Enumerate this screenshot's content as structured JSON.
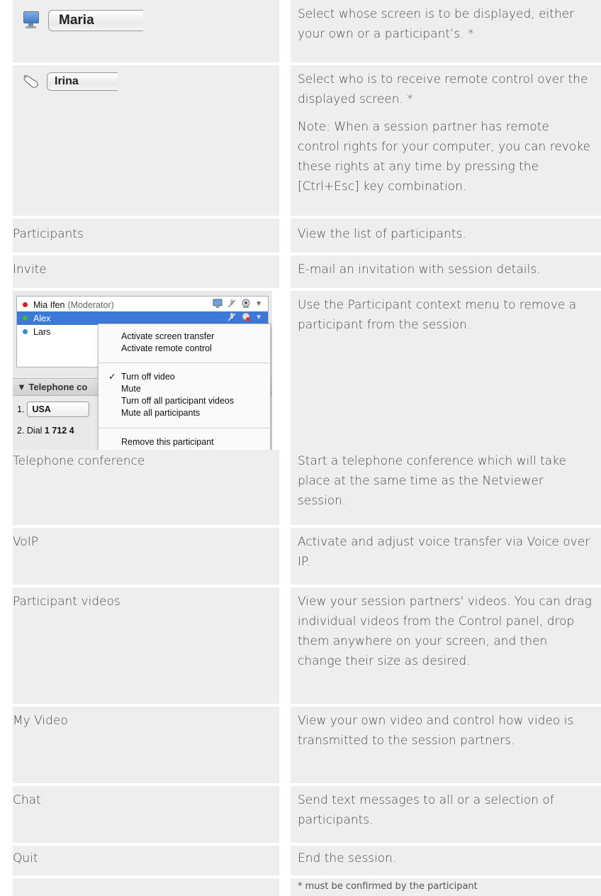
{
  "screen_selector": {
    "value": "Maria",
    "description": "Select whose screen is to be displayed, either your own or a participant’s. *"
  },
  "control_selector": {
    "value": "Irina",
    "description": "Select who is to receive remote control over the displayed screen. *",
    "note": "Note: When a session partner has remote control rights for your computer, you can revoke these rights at any time by pressing the [Ctrl+Esc] key combination."
  },
  "rows": {
    "participants": {
      "label": "Participants",
      "description": "View the list of participants."
    },
    "invite": {
      "label": "Invite",
      "description": "E-mail an invitation with session details."
    },
    "context_menu": {
      "description": "Use the Participant context menu to remove a participant from the session."
    },
    "telephone": {
      "label": "Telephone conference",
      "description": "Start a telephone conference which will take place at the same time as the Netviewer session."
    },
    "voip": {
      "label": "VoIP",
      "description": "Activate and adjust voice transfer via Voice over IP."
    },
    "participant_videos": {
      "label": "Participant videos",
      "description": "View your session partners' videos. You can drag individual videos from the Control panel, drop them anywhere on your screen, and then change their size as desired."
    },
    "my_video": {
      "label": "My Video",
      "description": "View your own video and control how video is transmitted to the session partners."
    },
    "chat": {
      "label": "Chat",
      "description": "Send text messages to all or a selection of participants."
    },
    "quit": {
      "label": "Quit",
      "description": "End the session."
    }
  },
  "footnote": "* must be confirmed by the participant",
  "screenshot": {
    "participants": [
      {
        "name": "Mia Ifen",
        "role": "(Moderator)",
        "dot_color": "#d42020"
      },
      {
        "name": "Alex",
        "role": "",
        "dot_color": "#43b82f"
      },
      {
        "name": "Lars",
        "role": "",
        "dot_color": "#2f8fd8"
      }
    ],
    "menu": {
      "activate_screen": "Activate screen transfer",
      "activate_remote": "Activate remote control",
      "check": "✓",
      "turn_off_video": "Turn off video",
      "mute": "Mute",
      "turn_off_all_videos": "Turn off all participant videos",
      "mute_all": "Mute all participants",
      "remove": "Remove this participant"
    },
    "telephone_header": "▼ Telephone co",
    "step1_label": "1.",
    "country": "USA",
    "dial_prefix": "2. Dial ",
    "dial_number": "1 712 4"
  },
  "colors": {
    "cell_bg": "#eeeeee",
    "selected_row": "#3c79d7"
  }
}
